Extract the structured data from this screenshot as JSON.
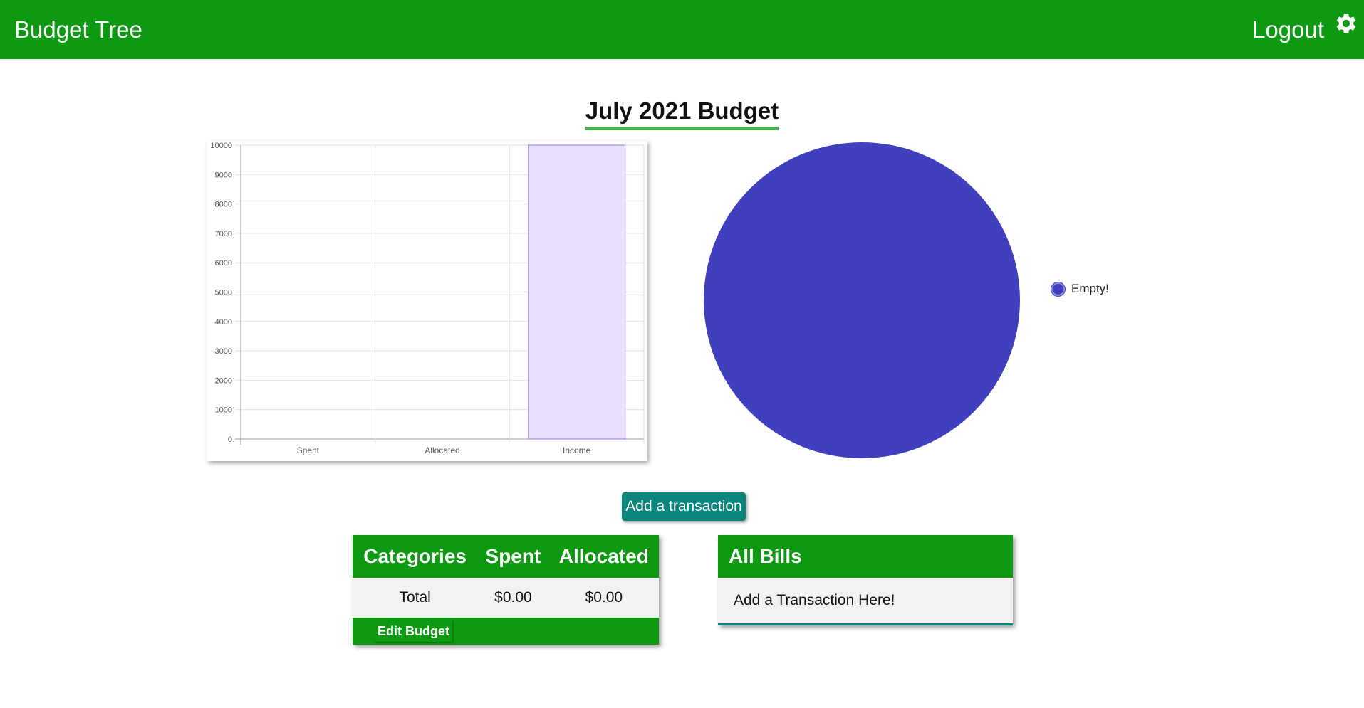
{
  "navbar": {
    "brand": "Budget Tree",
    "logout": "Logout",
    "settings_icon": "gear-icon",
    "color": "#0e9912"
  },
  "page": {
    "title": "July 2021 Budget"
  },
  "chart_data": [
    {
      "type": "bar",
      "categories": [
        "Spent",
        "Allocated",
        "Income"
      ],
      "values": [
        0,
        0,
        10000
      ],
      "ylim": [
        0,
        10000
      ],
      "yticks": [
        0,
        1000,
        2000,
        3000,
        4000,
        5000,
        6000,
        7000,
        8000,
        9000,
        10000
      ],
      "grid": true,
      "bar_fill": "#e8e0fe",
      "bar_stroke": "#a788e8"
    },
    {
      "type": "pie",
      "labels": [
        "Empty!"
      ],
      "values": [
        1
      ],
      "colors": [
        "#4040bf"
      ],
      "legend": "right"
    }
  ],
  "actions": {
    "add_transaction": "Add a transaction"
  },
  "budget_table": {
    "headers": [
      "Categories",
      "Spent",
      "Allocated"
    ],
    "rows": [
      [
        "Total",
        "$0.00",
        "$0.00"
      ]
    ],
    "edit_label": "Edit Budget"
  },
  "bills": {
    "title": "All Bills",
    "empty_message": "Add a Transaction Here!"
  }
}
